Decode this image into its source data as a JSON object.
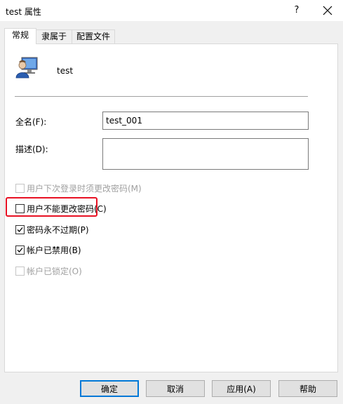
{
  "window": {
    "title": "test 属性",
    "help_glyph": "?"
  },
  "tabs": [
    {
      "label": "常规",
      "active": true
    },
    {
      "label": "隶属于",
      "active": false
    },
    {
      "label": "配置文件",
      "active": false
    }
  ],
  "general": {
    "user_name": "test",
    "full_name_label": "全名(F):",
    "full_name_value": "test_001",
    "description_label": "描述(D):",
    "description_value": ""
  },
  "options": [
    {
      "label": "用户下次登录时须更改密码(M)",
      "checked": false,
      "enabled": false
    },
    {
      "label": "用户不能更改密码(C)",
      "checked": false,
      "enabled": true
    },
    {
      "label": "密码永不过期(P)",
      "checked": true,
      "enabled": true
    },
    {
      "label": "帐户已禁用(B)",
      "checked": true,
      "enabled": true
    },
    {
      "label": "帐户已锁定(O)",
      "checked": false,
      "enabled": false
    }
  ],
  "buttons": {
    "ok": "确定",
    "cancel": "取消",
    "apply": "应用(A)",
    "help": "帮助"
  },
  "colors": {
    "highlight": "#e81123",
    "accent": "#0078d7"
  }
}
